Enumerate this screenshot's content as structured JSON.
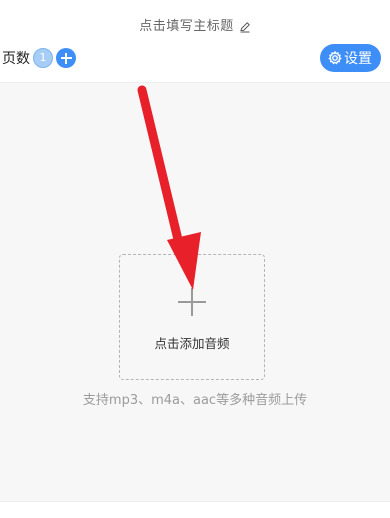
{
  "header": {
    "title": "点击填写主标题",
    "edit_icon": "pencil-icon"
  },
  "toolbar": {
    "page_label": "页数",
    "page_count": "1",
    "add_page_icon": "plus-icon",
    "settings_label": "设置",
    "settings_icon": "gear-icon"
  },
  "upload": {
    "plus_icon": "plus-icon",
    "label": "点击添加音频",
    "hint": "支持mp3、m4a、aac等多种音频上传"
  },
  "annotation": {
    "arrow_color": "#e8202a"
  },
  "colors": {
    "accent": "#3e8ef7",
    "badge": "#a6cdf5"
  }
}
